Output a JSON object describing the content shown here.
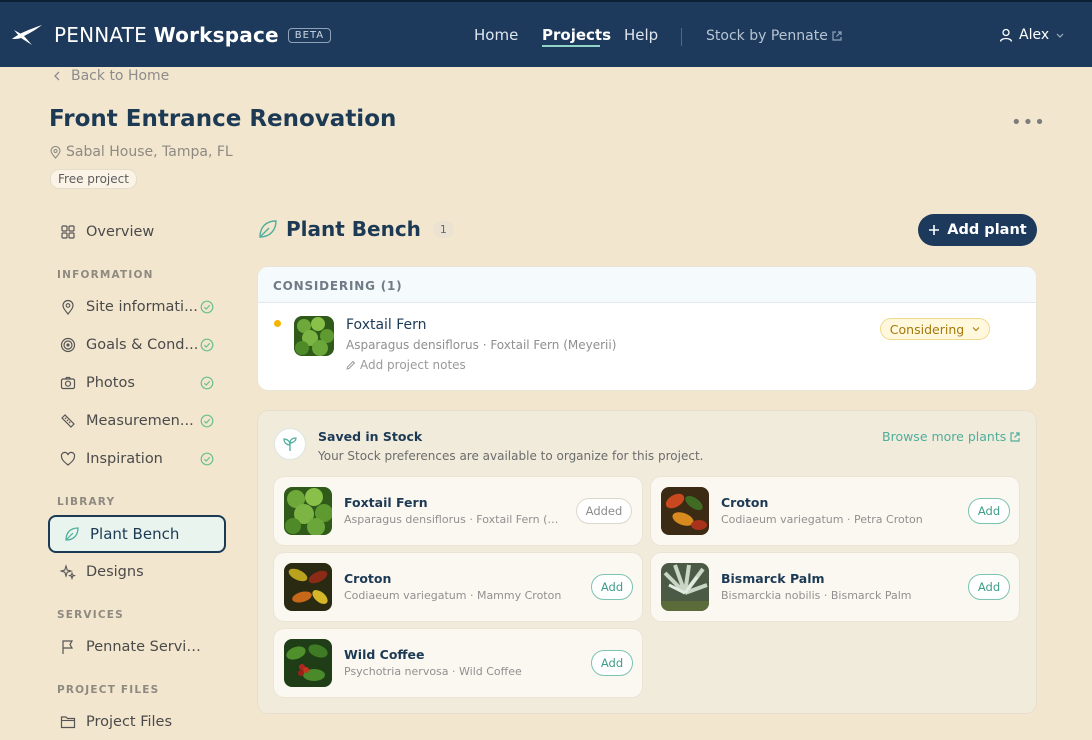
{
  "topbar": {
    "brand_light": "PENNATE",
    "brand_bold": "Workspace",
    "beta": "BETA",
    "nav": [
      "Home",
      "Projects",
      "Help"
    ],
    "active_nav": "Projects",
    "stock_link": "Stock by Pennate",
    "user": "Alex"
  },
  "header": {
    "back": "Back to Home",
    "title": "Front Entrance Renovation",
    "location": "Sabal House, Tampa, FL",
    "chip": "Free project"
  },
  "sidebar": {
    "overview": "Overview",
    "sections": {
      "information": "INFORMATION",
      "library": "LIBRARY",
      "services": "SERVICES",
      "project_files": "PROJECT FILES"
    },
    "information_items": [
      "Site informati...",
      "Goals & Cond...",
      "Photos",
      "Measuremen...",
      "Inspiration"
    ],
    "information_items_full": [
      "Site information",
      "Goals & Conditions",
      "Photos",
      "Measurements",
      "Inspiration"
    ],
    "library_items": [
      "Plant Bench",
      "Designs"
    ],
    "services_items": [
      "Pennate Services"
    ],
    "files_items": [
      "Project Files"
    ]
  },
  "main": {
    "title": "Plant Bench",
    "count": "1",
    "add_button": "Add plant",
    "considering": {
      "header": "CONSIDERING (1)",
      "plant": {
        "name": "Foxtail Fern",
        "scientific": "Asparagus densiflorus · Foxtail Fern (Meyerii)",
        "notes": "Add project notes",
        "status": "Considering"
      }
    },
    "stock": {
      "title": "Saved in Stock",
      "subtitle": "Your Stock preferences are available to organize for this project.",
      "browse": "Browse more plants",
      "plants": [
        {
          "name": "Foxtail Fern",
          "scientific": "Asparagus densiflorus · Foxtail Fern (M...",
          "action": "Added"
        },
        {
          "name": "Croton",
          "scientific": "Codiaeum variegatum · Petra Croton",
          "action": "Add"
        },
        {
          "name": "Croton",
          "scientific": "Codiaeum variegatum · Mammy Croton",
          "action": "Add"
        },
        {
          "name": "Bismarck Palm",
          "scientific": "Bismarckia nobilis · Bismarck Palm",
          "action": "Add"
        },
        {
          "name": "Wild Coffee",
          "scientific": "Psychotria nervosa · Wild Coffee",
          "action": "Add"
        }
      ]
    }
  },
  "colors": {
    "topbar": "#1d3a5c",
    "page_bg": "#f3e6cf",
    "accent_teal": "#4fae9b",
    "considering_dot": "#f4b400",
    "text_primary": "#1d3a55"
  }
}
